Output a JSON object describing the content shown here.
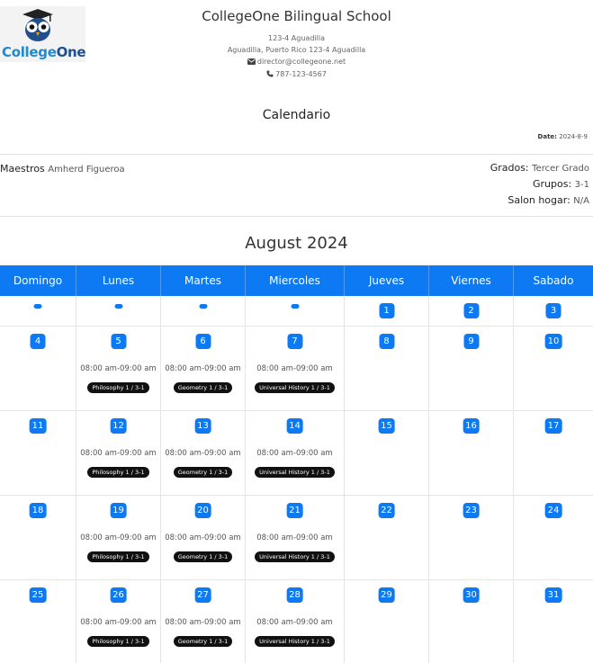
{
  "header": {
    "logo_text_a": "College",
    "logo_text_b": "One",
    "school_name": "CollegeOne Bilingual School",
    "address_line1": "123-4 Aguadilla",
    "address_line2": "Aguadilla, Puerto Rico 123-4 Aguadilla",
    "email": "director@collegeone.net",
    "phone": "787-123-4567"
  },
  "doc": {
    "title": "Calendario",
    "date_label": "Date:",
    "date_value": "2024-8-9"
  },
  "info": {
    "maestros_label": "Maestros",
    "maestros_value": "Amherd Figueroa",
    "grados_label": "Grados:",
    "grados_value": "Tercer Grado",
    "grupos_label": "Grupos:",
    "grupos_value": "3-1",
    "salon_label": "Salon hogar:",
    "salon_value": "N/A"
  },
  "calendar": {
    "month": "August 2024",
    "days": [
      "Domingo",
      "Lunes",
      "Martes",
      "Miercoles",
      "Jueves",
      "Viernes",
      "Sabado"
    ],
    "week0": [
      "1",
      "2",
      "3"
    ],
    "weeks": [
      [
        "4",
        "5",
        "6",
        "7",
        "8",
        "9",
        "10"
      ],
      [
        "11",
        "12",
        "13",
        "14",
        "15",
        "16",
        "17"
      ],
      [
        "18",
        "19",
        "20",
        "21",
        "22",
        "23",
        "24"
      ],
      [
        "25",
        "26",
        "27",
        "28",
        "29",
        "30",
        "31"
      ]
    ],
    "event_time": "08:00 am-09:00 am",
    "events": {
      "lunes": "Philosophy 1 / 3-1",
      "martes": "Geometry 1 / 3-1",
      "miercoles": "Universal History 1 / 3-1"
    }
  },
  "colors": {
    "primary": "#0d79f2",
    "badge": "#111111"
  },
  "icons": [
    "owl-logo-icon",
    "envelope-icon",
    "phone-icon"
  ]
}
